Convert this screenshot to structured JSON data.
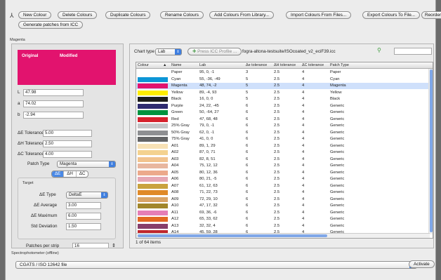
{
  "toolbar": {
    "buttons": [
      "New Colour",
      "Delete Colours",
      "Duplicate Colours",
      "Rename Colours",
      "Add Colours From Library...",
      "Import Colours From Files...",
      "Export Colours To File...",
      "Reorder patches",
      "Generate patches from ICC"
    ]
  },
  "magenta_group": {
    "label": "Magenta"
  },
  "swatch": {
    "original": "Original",
    "modified": "Modified",
    "color": "#e2136e"
  },
  "lab": {
    "L_label": "L",
    "L": "47.98",
    "a_label": "a",
    "a": "74.02",
    "b_label": "b",
    "b": "-2.94"
  },
  "tolerances": {
    "de_label": "ΔE Tolerance",
    "de": "5.00",
    "dh_label": "ΔH Tolerance",
    "dh": "2.50",
    "dc_label": "ΔC Tolerance",
    "dc": "4.00"
  },
  "patch_type": {
    "label": "Patch Type",
    "value": "Magenta"
  },
  "segments": [
    "ΔE",
    "ΔH",
    "ΔC"
  ],
  "target": {
    "label": "Target",
    "type_label": "ΔE Type",
    "type": "DeltaE",
    "avg_label": "ΔE Average",
    "avg": "3.00",
    "max_label": "ΔE Maximum",
    "max": "6.00",
    "std_label": "Std Deviation",
    "std": "1.50"
  },
  "patches_per_strip": {
    "label": "Patches per strip",
    "value": "16"
  },
  "chart": {
    "type_label": "Chart type",
    "type": "Lab",
    "press_btn": "Press ICC Profile ...",
    "profile": "fogra-altona-testsuite/ISOcoated_v2_eciF39.icc",
    "search": ""
  },
  "table": {
    "headers": [
      "Colour",
      "Name",
      "Lab",
      "Δe tolerance",
      "ΔH tolerance",
      "ΔC tolerance",
      "Patch Type"
    ],
    "rows": [
      {
        "c": "#ffffff",
        "name": "Paper",
        "lab": "95, 0, -1",
        "de": "3",
        "dh": "2.5",
        "dc": "4",
        "pt": "Paper"
      },
      {
        "c": "#0d96d6",
        "name": "Cyan",
        "lab": "55, -36, -49",
        "de": "5",
        "dh": "2.5",
        "dc": "4",
        "pt": "Cyan"
      },
      {
        "c": "#e2136e",
        "name": "Magenta",
        "lab": "48, 74, -2",
        "de": "5",
        "dh": "2.5",
        "dc": "4",
        "pt": "Magenta"
      },
      {
        "c": "#ffed00",
        "name": "Yellow",
        "lab": "89, -4, 93",
        "de": "5",
        "dh": "2.5",
        "dc": "4",
        "pt": "Yellow"
      },
      {
        "c": "#1d1d1b",
        "name": "Black",
        "lab": "16, 0, 0",
        "de": "5",
        "dh": "2.5",
        "dc": "4",
        "pt": "Black"
      },
      {
        "c": "#2e2a6f",
        "name": "Purple",
        "lab": "24, 22, -45",
        "de": "6",
        "dh": "2.5",
        "dc": "4",
        "pt": "Generic"
      },
      {
        "c": "#00933f",
        "name": "Green",
        "lab": "50, -64, 27",
        "de": "6",
        "dh": "2.5",
        "dc": "4",
        "pt": "Generic"
      },
      {
        "c": "#d5222d",
        "name": "Red",
        "lab": "47, 68, 48",
        "de": "6",
        "dh": "2.5",
        "dc": "4",
        "pt": "Generic"
      },
      {
        "c": "#c5c6c8",
        "name": "25% Gray",
        "lab": "79, 0, -1",
        "de": "6",
        "dh": "2.5",
        "dc": "4",
        "pt": "Generic"
      },
      {
        "c": "#8e8f92",
        "name": "50% Gray",
        "lab": "62, 0, -1",
        "de": "6",
        "dh": "2.5",
        "dc": "4",
        "pt": "Generic"
      },
      {
        "c": "#636466",
        "name": "75% Gray",
        "lab": "41, 0, 0",
        "de": "6",
        "dh": "2.5",
        "dc": "4",
        "pt": "Generic"
      },
      {
        "c": "#f7e1b5",
        "name": "A01",
        "lab": "89, 1, 29",
        "de": "6",
        "dh": "2.5",
        "dc": "4",
        "pt": "Generic"
      },
      {
        "c": "#f4d28f",
        "name": "A02",
        "lab": "87, 0, 71",
        "de": "6",
        "dh": "2.5",
        "dc": "4",
        "pt": "Generic"
      },
      {
        "c": "#f1c38e",
        "name": "A03",
        "lab": "82, 8, 51",
        "de": "6",
        "dh": "2.5",
        "dc": "4",
        "pt": "Generic"
      },
      {
        "c": "#e8b79f",
        "name": "A04",
        "lab": "75, 12, 12",
        "de": "6",
        "dh": "2.5",
        "dc": "4",
        "pt": "Generic"
      },
      {
        "c": "#eca98b",
        "name": "A05",
        "lab": "80, 12, 36",
        "de": "6",
        "dh": "2.5",
        "dc": "4",
        "pt": "Generic"
      },
      {
        "c": "#e6a7b4",
        "name": "A06",
        "lab": "80, 21, -5",
        "de": "6",
        "dh": "2.5",
        "dc": "4",
        "pt": "Generic"
      },
      {
        "c": "#c9a23e",
        "name": "A07",
        "lab": "61, 12, 63",
        "de": "6",
        "dh": "2.5",
        "dc": "4",
        "pt": "Generic"
      },
      {
        "c": "#e08a28",
        "name": "A08",
        "lab": "71, 22, 73",
        "de": "6",
        "dh": "2.5",
        "dc": "4",
        "pt": "Generic"
      },
      {
        "c": "#d9a466",
        "name": "A09",
        "lab": "72, 29, 10",
        "de": "6",
        "dh": "2.5",
        "dc": "4",
        "pt": "Generic"
      },
      {
        "c": "#a2862a",
        "name": "A10",
        "lab": "47, 17, 32",
        "de": "6",
        "dh": "2.5",
        "dc": "4",
        "pt": "Generic"
      },
      {
        "c": "#e57eb6",
        "name": "A11",
        "lab": "69, 36, -6",
        "de": "6",
        "dh": "2.5",
        "dc": "4",
        "pt": "Generic"
      },
      {
        "c": "#e36922",
        "name": "A12",
        "lab": "65, 33, 62",
        "de": "6",
        "dh": "2.5",
        "dc": "4",
        "pt": "Generic"
      },
      {
        "c": "#873e6b",
        "name": "A13",
        "lab": "32, 32, 4",
        "de": "6",
        "dh": "2.5",
        "dc": "4",
        "pt": "Generic"
      },
      {
        "c": "#c1272d",
        "name": "A14",
        "lab": "45, 59, 28",
        "de": "6",
        "dh": "2.5",
        "dc": "4",
        "pt": "Generic"
      }
    ],
    "footer": "1 of 64 items"
  },
  "spectro": {
    "label": "Spectrophotometer (offline)",
    "device": "CGATS / ISO 12642 file",
    "activate": "Activate"
  }
}
